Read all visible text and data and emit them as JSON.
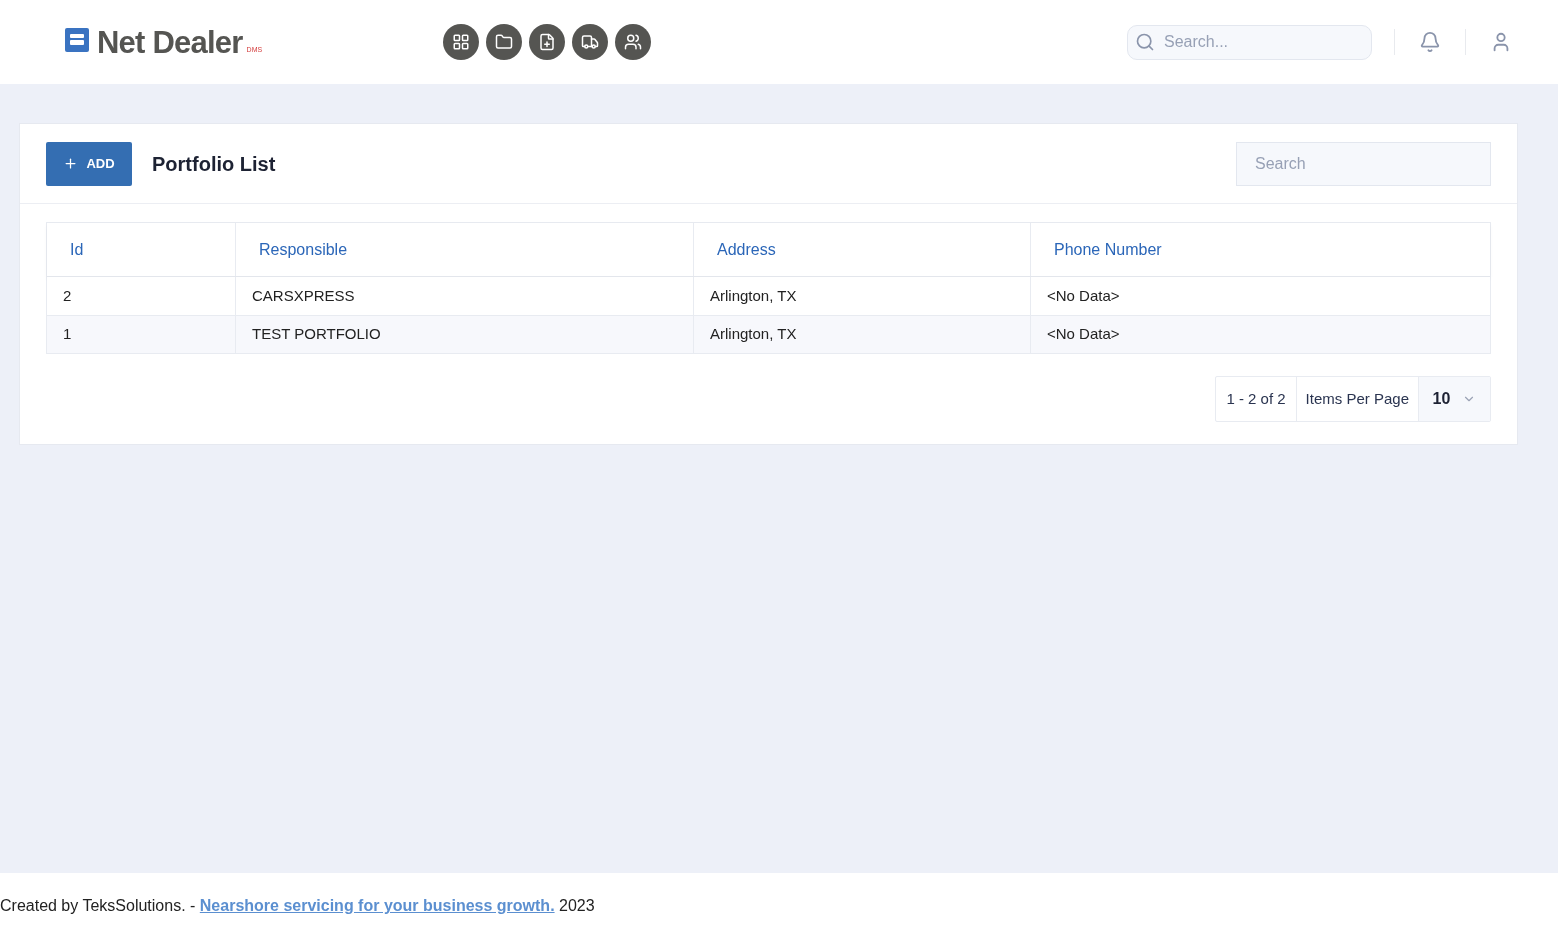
{
  "header": {
    "logo": {
      "name": "Net Dealer",
      "suffix": "DMS"
    },
    "nav_icons": [
      {
        "kind": "grid"
      },
      {
        "kind": "folder"
      },
      {
        "kind": "file-plus"
      },
      {
        "kind": "truck"
      },
      {
        "kind": "users"
      }
    ],
    "search": {
      "placeholder": "Search..."
    }
  },
  "card": {
    "add_button": "ADD",
    "title": "Portfolio List",
    "search": {
      "placeholder": "Search"
    },
    "table": {
      "columns": [
        "Id",
        "Responsible",
        "Address",
        "Phone Number"
      ],
      "rows": [
        [
          "2",
          "CARSXPRESS",
          "Arlington, TX",
          "<No Data>"
        ],
        [
          "1",
          "TEST PORTFOLIO",
          "Arlington, TX",
          "<No Data>"
        ]
      ]
    },
    "pagination": {
      "range": "1 - 2 of 2",
      "label": "Items Per Page",
      "per_page": "10"
    }
  },
  "footer": {
    "before": "Created by TeksSolutions. - ",
    "link": "Nearshore servicing for your business growth.",
    "after": " 2023"
  }
}
